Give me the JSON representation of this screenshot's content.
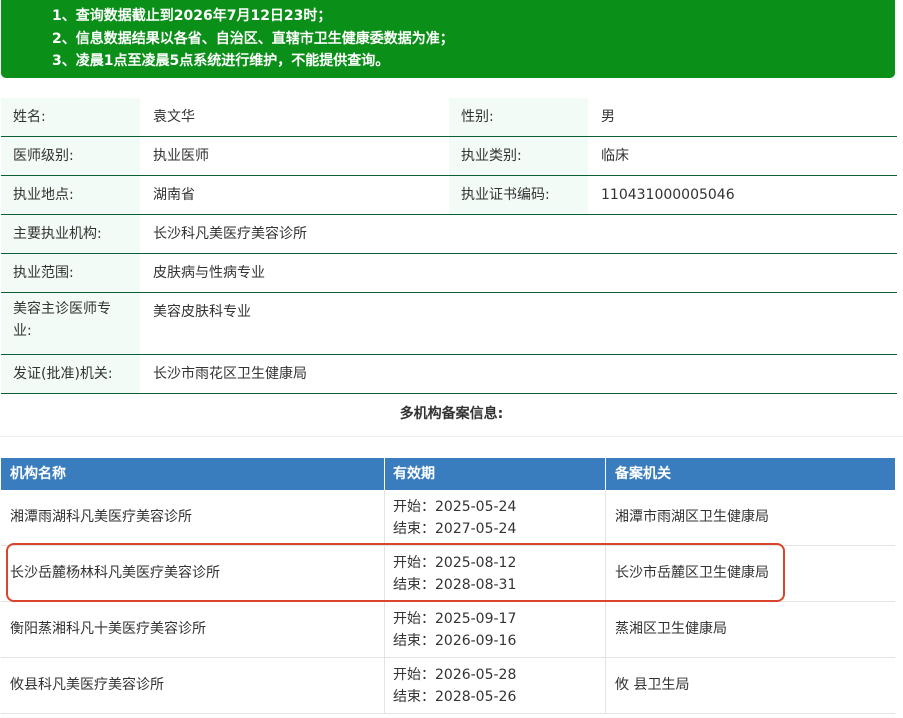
{
  "notice": {
    "lines": [
      "1、查询数据截止到2026年7月12日23时；",
      "2、信息数据结果以各省、自治区、直辖市卫生健康委数据为准；",
      "3、凌晨1点至凌晨5点系统进行维护，不能提供查询。"
    ]
  },
  "doctor": {
    "name_label": "姓名:",
    "name": "袁文华",
    "gender_label": "性别:",
    "gender": "男",
    "level_label": "医师级别:",
    "level": "执业医师",
    "category_label": "执业类别:",
    "category": "临床",
    "location_label": "执业地点:",
    "location": "湖南省",
    "cert_label": "执业证书编码:",
    "cert": "110431000005046",
    "institution_label": "主要执业机构:",
    "institution": "长沙科凡美医疗美容诊所",
    "scope_label": "执业范围:",
    "scope": "皮肤病与性病专业",
    "specialty_label_1": "美容主诊医师专",
    "specialty_label_2": "业:",
    "specialty": "美容皮肤科专业",
    "issuer_label": "发证(批准)机关:",
    "issuer": "长沙市雨花区卫生健康局"
  },
  "multi": {
    "title": "多机构备案信息:",
    "headers": {
      "name": "机构名称",
      "validity": "有效期",
      "agency": "备案机关"
    },
    "rows": [
      {
        "name": "湘潭雨湖科凡美医疗美容诊所",
        "start": "开始：2025-05-24",
        "end": "结束：2027-05-24",
        "agency": "湘潭市雨湖区卫生健康局"
      },
      {
        "name": "长沙岳麓杨林科凡美医疗美容诊所",
        "start": "开始：2025-08-12",
        "end": "结束：2028-08-31",
        "agency": "长沙市岳麓区卫生健康局"
      },
      {
        "name": "衡阳蒸湘科凡十美医疗美容诊所",
        "start": "开始：2025-09-17",
        "end": "结束：2026-09-16",
        "agency": "蒸湘区卫生健康局"
      },
      {
        "name": "攸县科凡美医疗美容诊所",
        "start": "开始：2026-05-28",
        "end": "结束：2028-05-26",
        "agency": "攸 县卫生局"
      }
    ]
  },
  "colors": {
    "notice_bg": "#0a8f18",
    "table_header": "#3a7dbe",
    "highlight": "#d9452c",
    "row_border": "#0b5e36"
  }
}
